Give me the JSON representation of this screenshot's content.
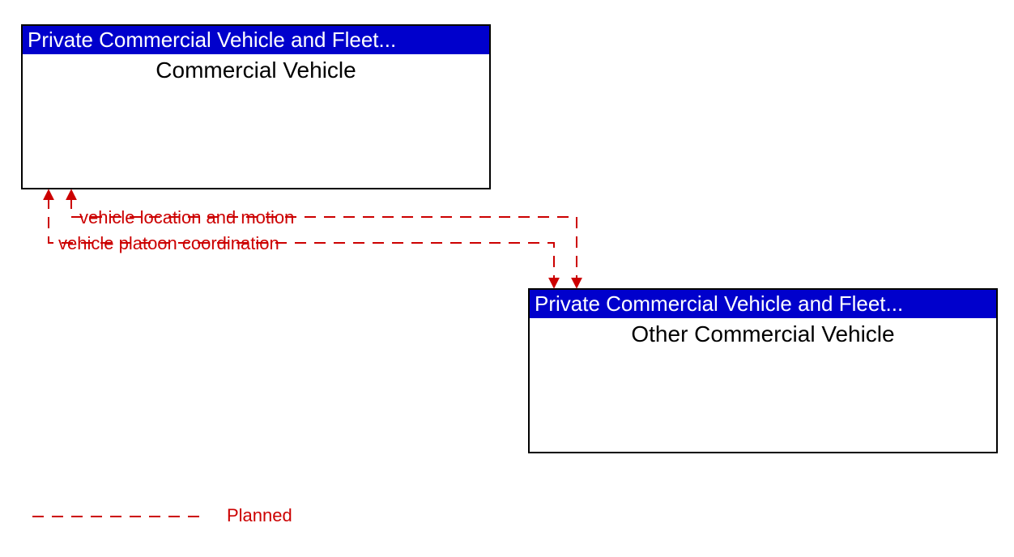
{
  "boxes": {
    "top": {
      "header": "Private Commercial Vehicle and Fleet...",
      "title": "Commercial Vehicle"
    },
    "bottom": {
      "header": "Private Commercial Vehicle and Fleet...",
      "title": "Other Commercial Vehicle"
    }
  },
  "flows": {
    "flow1": "vehicle location and motion",
    "flow2": "vehicle platoon coordination"
  },
  "legend": {
    "planned": "Planned"
  },
  "colors": {
    "header_bg": "#0000cc",
    "header_text": "#ffffff",
    "flow_line": "#cc0000",
    "box_border": "#000000"
  }
}
